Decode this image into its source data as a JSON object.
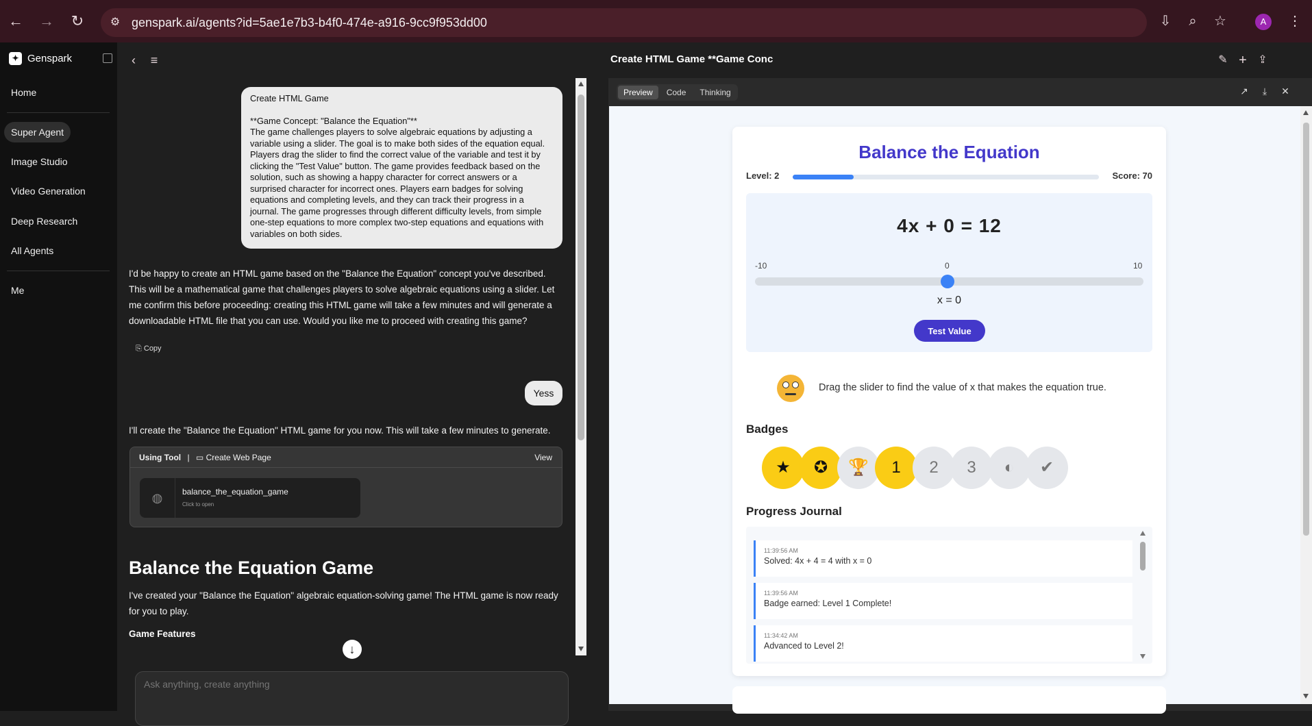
{
  "browser": {
    "url": "genspark.ai/agents?id=5ae1e7b3-b4f0-474e-a916-9cc9f953dd00",
    "profile_initial": "A"
  },
  "sidebar": {
    "brand": "Genspark",
    "items": [
      {
        "label": "Home"
      },
      {
        "label": "Super Agent"
      },
      {
        "label": "Image Studio"
      },
      {
        "label": "Video Generation"
      },
      {
        "label": "Deep Research"
      },
      {
        "label": "All Agents"
      },
      {
        "label": "Me"
      }
    ]
  },
  "header": {
    "title": "Create HTML Game **Game Conc"
  },
  "chat": {
    "user_message_title": "Create HTML Game",
    "user_message_body": "**Game Concept: \"Balance the Equation\"**\nThe game challenges players to solve algebraic equations by adjusting a variable using a slider. The goal is to make both sides of the equation equal. Players drag the slider to find the correct value of the variable and test it by clicking the \"Test Value\" button. The game provides feedback based on the solution, such as showing a happy character for correct answers or a surprised character for incorrect ones. Players earn badges for solving equations and completing levels, and they can track their progress in a journal. The game progresses through different difficulty levels, from simple one-step equations to more complex two-step equations and equations with variables on both sides.",
    "assistant_reply_1": "I'd be happy to create an HTML game based on the \"Balance the Equation\" concept you've described. This will be a mathematical game that challenges players to solve algebraic equations using a slider. Let me confirm this before proceeding: creating this HTML game will take a few minutes and will generate a downloadable HTML file that you can use. Would you like me to proceed with creating this game?",
    "copy_label": "Copy",
    "user_message_2": "Yess",
    "assistant_reply_2": "I'll create the \"Balance the Equation\" HTML game for you now. This will take a few minutes to generate.",
    "tool": {
      "using_label": "Using Tool",
      "separator": "|",
      "name": "Create Web Page",
      "view_label": "View",
      "file_name": "balance_the_equation_game",
      "file_sub": "Click to open"
    },
    "result_heading": "Balance the Equation Game",
    "result_text": "I've created your \"Balance the Equation\" algebraic equation-solving game! The HTML game is now ready for you to play.",
    "features_heading": "Game Features",
    "composer_placeholder": "Ask anything, create anything"
  },
  "preview": {
    "tabs": [
      "Preview",
      "Code",
      "Thinking"
    ],
    "active_tab": "Preview"
  },
  "game": {
    "title": "Balance the Equation",
    "level_label": "Level: 2",
    "score_label": "Score: 70",
    "level_progress": 0.2,
    "equation": "4x + 0 = 12",
    "slider_min": "-10",
    "slider_mid": "0",
    "slider_max": "10",
    "slider_value": 0,
    "x_display": "x = 0",
    "test_button": "Test Value",
    "hint": "Drag the slider to find the value of x that makes the equation true.",
    "badges_heading": "Badges",
    "badges": [
      {
        "icon": "★",
        "earned": true
      },
      {
        "icon": "✪",
        "earned": true
      },
      {
        "icon": "🏆",
        "earned": false
      },
      {
        "icon": "1",
        "earned": true
      },
      {
        "icon": "2",
        "earned": false
      },
      {
        "icon": "3",
        "earned": false
      },
      {
        "icon": "◐",
        "earned": false
      },
      {
        "icon": "✔",
        "earned": false
      }
    ],
    "journal_heading": "Progress Journal",
    "journal": [
      {
        "time": "11:39:56 AM",
        "text": "Solved: 4x + 4 = 4 with x = 0"
      },
      {
        "time": "11:39:56 AM",
        "text": "Badge earned: Level 1 Complete!"
      },
      {
        "time": "11:34:42 AM",
        "text": "Advanced to Level 2!"
      }
    ]
  }
}
